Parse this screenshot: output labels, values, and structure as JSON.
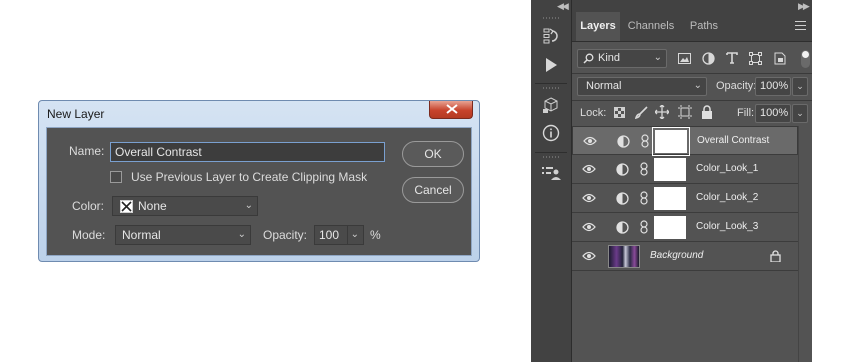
{
  "dialog": {
    "title": "New Layer",
    "name_label": "Name:",
    "name_value": "Overall Contrast",
    "clip_label": "Use Previous Layer to Create Clipping Mask",
    "color_label": "Color:",
    "color_value": "None",
    "mode_label": "Mode:",
    "mode_value": "Normal",
    "opacity_label": "Opacity:",
    "opacity_value": "100",
    "opacity_unit": "%",
    "ok_label": "OK",
    "cancel_label": "Cancel"
  },
  "panel": {
    "tabs": [
      {
        "label": "Layers",
        "active": true
      },
      {
        "label": "Channels",
        "active": false
      },
      {
        "label": "Paths",
        "active": false
      }
    ],
    "filter_kind": "Kind",
    "blend_mode": "Normal",
    "opacity_label": "Opacity:",
    "opacity_value": "100%",
    "lock_label": "Lock:",
    "fill_label": "Fill:",
    "fill_value": "100%",
    "layers": [
      {
        "name": "Overall Contrast",
        "selected": true
      },
      {
        "name": "Color_Look_1",
        "selected": false
      },
      {
        "name": "Color_Look_2",
        "selected": false
      },
      {
        "name": "Color_Look_3",
        "selected": false
      },
      {
        "name": "Background",
        "selected": false
      }
    ]
  },
  "colors": {
    "panel_bg": "#535353",
    "dark_bg": "#424242",
    "selected_row": "#6a6a6a",
    "close_red": "#c7432c"
  }
}
